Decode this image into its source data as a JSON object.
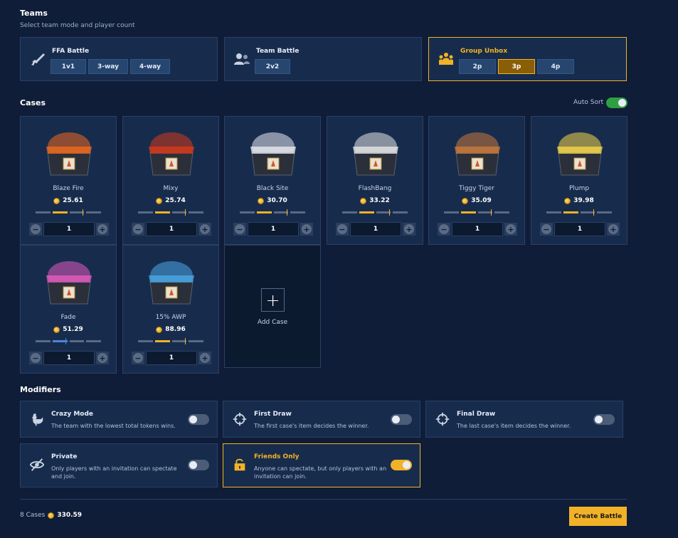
{
  "teams": {
    "title": "Teams",
    "subtitle": "Select team mode and player count",
    "modes": [
      {
        "name": "FFA Battle",
        "icon": "rifle-icon",
        "options": [
          "1v1",
          "3-way",
          "4-way"
        ],
        "selected": null
      },
      {
        "name": "Team Battle",
        "icon": "users-icon",
        "options": [
          "2v2"
        ],
        "selected": null
      },
      {
        "name": "Group Unbox",
        "icon": "group-icon",
        "options": [
          "2p",
          "3p",
          "4p"
        ],
        "selected": "3p"
      }
    ]
  },
  "cases": {
    "title": "Cases",
    "auto_sort_label": "Auto Sort",
    "auto_sort_on": true,
    "items": [
      {
        "name": "Blaze Fire",
        "price": "25.61",
        "qty": "1",
        "color": "#f06a1d"
      },
      {
        "name": "Mixy",
        "price": "25.74",
        "qty": "1",
        "color": "#d63a1a"
      },
      {
        "name": "Black Site",
        "price": "30.70",
        "qty": "1",
        "color": "#e8e8f0"
      },
      {
        "name": "FlashBang",
        "price": "33.22",
        "qty": "1",
        "color": "#e6e6e6"
      },
      {
        "name": "Tiggy Tiger",
        "price": "35.09",
        "qty": "1",
        "color": "#c97a3c"
      },
      {
        "name": "Plump",
        "price": "39.98",
        "qty": "1",
        "color": "#f5d64a"
      },
      {
        "name": "Fade",
        "price": "51.29",
        "qty": "1",
        "color": "#e25bbd"
      },
      {
        "name": "15% AWP",
        "price": "88.96",
        "qty": "1",
        "color": "#4aa8e6"
      }
    ],
    "add_label": "Add Case"
  },
  "modifiers": {
    "title": "Modifiers",
    "items": [
      {
        "name": "Crazy Mode",
        "desc": "The team with the lowest total tokens wins.",
        "icon": "chicken-icon",
        "on": false
      },
      {
        "name": "First Draw",
        "desc": "The first case's item decides the winner.",
        "icon": "crosshair-icon",
        "on": false
      },
      {
        "name": "Final Draw",
        "desc": "The last case's item decides the winner.",
        "icon": "crosshair-icon",
        "on": false
      },
      {
        "name": "Private",
        "desc": "Only players with an invitation can spectate and join.",
        "icon": "eye-off-icon",
        "on": false
      },
      {
        "name": "Friends Only",
        "desc": "Anyone can spectate, but only players with an invitation can join.",
        "icon": "unlock-icon",
        "on": true
      }
    ]
  },
  "footer": {
    "count": "8 Cases",
    "total": "330.59",
    "create_label": "Create Battle"
  },
  "colors": {
    "accent": "#f2b227",
    "bg": "#0f1d38",
    "card": "#172c4d",
    "toggle_green": "#2ea043"
  }
}
